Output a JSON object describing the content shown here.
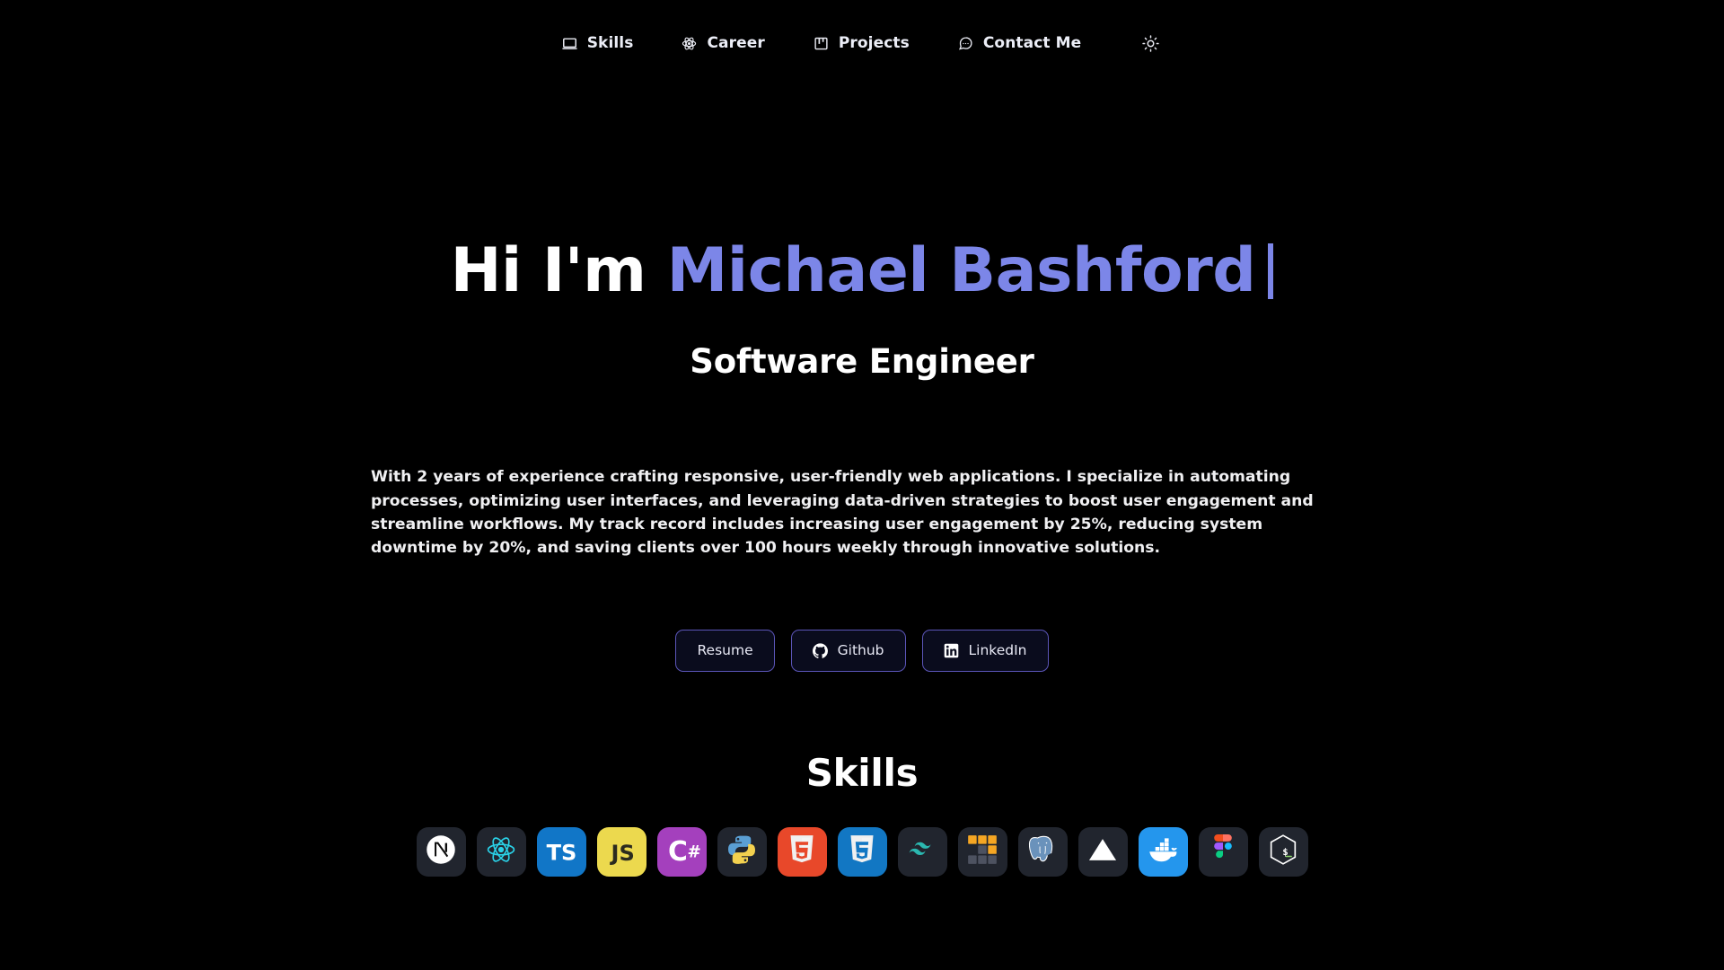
{
  "theme": {
    "background": "#000000",
    "accent": "#7c86e8",
    "button_bg": "#0a0c1d",
    "button_border": "#5b55b8",
    "text": "#ffffff"
  },
  "navbar": {
    "items": [
      {
        "label": "Skills",
        "icon": "monitor-icon"
      },
      {
        "label": "Career",
        "icon": "atom-icon"
      },
      {
        "label": "Projects",
        "icon": "kanban-icon"
      },
      {
        "label": "Contact Me",
        "icon": "message-icon"
      }
    ],
    "theme_toggle_icon": "sun-icon"
  },
  "hero": {
    "greeting": "Hi I'm ",
    "name": "Michael Bashford",
    "subtitle": "Software Engineer",
    "description": "With 2 years of experience crafting responsive, user-friendly web applications. I specialize in automating processes, optimizing user interfaces, and leveraging data-driven strategies to boost user engagement and streamline workflows. My track record includes increasing user engagement by 25%, reducing system downtime by 20%, and saving clients over 100 hours weekly through innovative solutions.",
    "buttons": [
      {
        "label": "Resume",
        "icon": ""
      },
      {
        "label": "Github",
        "icon": "github-icon"
      },
      {
        "label": "LinkedIn",
        "icon": "linkedin-icon"
      }
    ]
  },
  "skills": {
    "heading": "Skills",
    "items": [
      {
        "name": "Next.js",
        "icon": "nextjs-icon"
      },
      {
        "name": "React",
        "icon": "react-icon"
      },
      {
        "name": "TypeScript",
        "icon": "typescript-icon"
      },
      {
        "name": "JavaScript",
        "icon": "javascript-icon"
      },
      {
        "name": "C#",
        "icon": "csharp-icon"
      },
      {
        "name": "Python",
        "icon": "python-icon"
      },
      {
        "name": "HTML5",
        "icon": "html5-icon"
      },
      {
        "name": "CSS3",
        "icon": "css3-icon"
      },
      {
        "name": "Tailwind CSS",
        "icon": "tailwind-icon"
      },
      {
        "name": "pnpm",
        "icon": "pnpm-icon"
      },
      {
        "name": "PostgreSQL",
        "icon": "postgresql-icon"
      },
      {
        "name": "Vercel",
        "icon": "vercel-icon"
      },
      {
        "name": "Docker",
        "icon": "docker-icon"
      },
      {
        "name": "Figma",
        "icon": "figma-icon"
      },
      {
        "name": "Bash",
        "icon": "bash-icon"
      }
    ]
  }
}
